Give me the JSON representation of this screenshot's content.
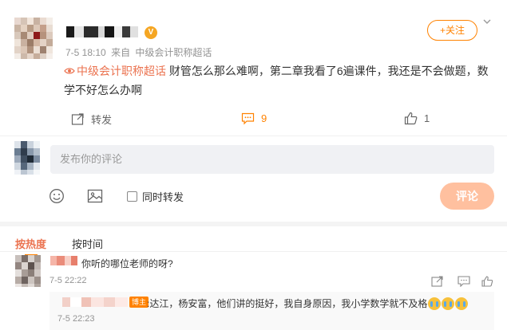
{
  "post": {
    "time": "7-5 18:10",
    "source_prefix": "来自",
    "source": "中级会计职称超话",
    "follow_label": "+关注",
    "topic": "中级会计职称超话",
    "text": " 财管怎么那么难啊，第二章我看了6遍课件，我还是不会做题，数学不好怎么办啊",
    "actions": {
      "repost_label": "转发",
      "comment_count": "9",
      "like_count": "1"
    }
  },
  "composer": {
    "placeholder": "发布你的评论",
    "repost_label": "同时转发",
    "submit_label": "评论"
  },
  "sort": {
    "hot_label": "按热度",
    "time_label": "按时间"
  },
  "comments": [
    {
      "text": "你听的哪位老师的呀?",
      "time": "7-5 22:22",
      "reply": {
        "badge": "博主",
        "text": ":达江，杨安富，他们讲的挺好，我自身原因，我小学数学就不及格",
        "time": "7-5 22:23"
      }
    }
  ],
  "colors": {
    "accent": "#ff8200",
    "topic": "#eb7350",
    "submit_disabled": "#ffc09f",
    "meta_text": "#939393"
  }
}
